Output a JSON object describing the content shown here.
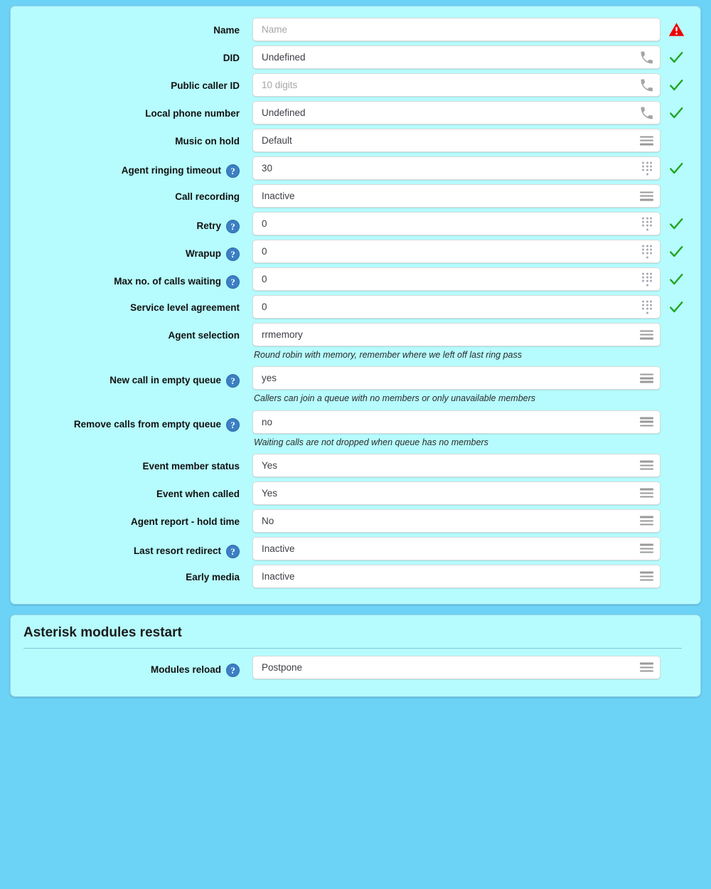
{
  "colors": {
    "page_background": "#6cd2f6",
    "panel_background": "#b6fbfd",
    "panel_border": "#8fd4e8",
    "field_background": "#ffffff",
    "help_badge": "#3b7fc4",
    "status_ok": "#22a522",
    "status_error": "#ee0000"
  },
  "queue_form": {
    "rows": [
      {
        "label": "Name",
        "help": false,
        "type": "text",
        "value": "Name",
        "is_placeholder": true,
        "field_icon": "none",
        "status": "error",
        "helper": ""
      },
      {
        "label": "DID",
        "help": false,
        "type": "text",
        "value": "Undefined",
        "is_placeholder": false,
        "field_icon": "phone",
        "status": "ok",
        "helper": ""
      },
      {
        "label": "Public caller ID",
        "help": false,
        "type": "text",
        "value": "10 digits",
        "is_placeholder": true,
        "field_icon": "phone",
        "status": "ok",
        "helper": ""
      },
      {
        "label": "Local phone number",
        "help": false,
        "type": "text",
        "value": "Undefined",
        "is_placeholder": false,
        "field_icon": "phone",
        "status": "ok",
        "helper": ""
      },
      {
        "label": "Music on hold",
        "help": false,
        "type": "select",
        "value": "Default",
        "is_placeholder": false,
        "field_icon": "menu",
        "status": "none",
        "helper": ""
      },
      {
        "label": "Agent ringing timeout",
        "help": true,
        "type": "number",
        "value": "30",
        "is_placeholder": false,
        "field_icon": "dialpad",
        "status": "ok",
        "helper": ""
      },
      {
        "label": "Call recording",
        "help": false,
        "type": "select",
        "value": "Inactive",
        "is_placeholder": false,
        "field_icon": "menu",
        "status": "none",
        "helper": ""
      },
      {
        "label": "Retry",
        "help": true,
        "type": "number",
        "value": "0",
        "is_placeholder": false,
        "field_icon": "dialpad",
        "status": "ok",
        "helper": ""
      },
      {
        "label": "Wrapup",
        "help": true,
        "type": "number",
        "value": "0",
        "is_placeholder": false,
        "field_icon": "dialpad",
        "status": "ok",
        "helper": ""
      },
      {
        "label": "Max no. of calls waiting",
        "help": true,
        "type": "number",
        "value": "0",
        "is_placeholder": false,
        "field_icon": "dialpad",
        "status": "ok",
        "helper": ""
      },
      {
        "label": "Service level agreement",
        "help": false,
        "type": "number",
        "value": "0",
        "is_placeholder": false,
        "field_icon": "dialpad",
        "status": "ok",
        "helper": ""
      },
      {
        "label": "Agent selection",
        "help": false,
        "type": "select",
        "value": "rrmemory",
        "is_placeholder": false,
        "field_icon": "menu",
        "status": "none",
        "helper": "Round robin with memory, remember where we left off last ring pass"
      },
      {
        "label": "New call in empty queue",
        "help": true,
        "type": "select",
        "value": "yes",
        "is_placeholder": false,
        "field_icon": "menu",
        "status": "none",
        "helper": "Callers can join a queue with no members or only unavailable members"
      },
      {
        "label": "Remove calls from empty queue",
        "help": true,
        "type": "select",
        "value": "no",
        "is_placeholder": false,
        "field_icon": "menu",
        "status": "none",
        "helper": "Waiting calls are not dropped when queue has no members"
      },
      {
        "label": "Event member status",
        "help": false,
        "type": "select",
        "value": "Yes",
        "is_placeholder": false,
        "field_icon": "menu",
        "status": "none",
        "helper": ""
      },
      {
        "label": "Event when called",
        "help": false,
        "type": "select",
        "value": "Yes",
        "is_placeholder": false,
        "field_icon": "menu",
        "status": "none",
        "helper": ""
      },
      {
        "label": "Agent report - hold time",
        "help": false,
        "type": "select",
        "value": "No",
        "is_placeholder": false,
        "field_icon": "menu",
        "status": "none",
        "helper": ""
      },
      {
        "label": "Last resort redirect",
        "help": true,
        "type": "select",
        "value": "Inactive",
        "is_placeholder": false,
        "field_icon": "menu",
        "status": "none",
        "helper": ""
      },
      {
        "label": "Early media",
        "help": false,
        "type": "select",
        "value": "Inactive",
        "is_placeholder": false,
        "field_icon": "menu",
        "status": "none",
        "helper": ""
      }
    ]
  },
  "modules_panel": {
    "title": "Asterisk modules restart",
    "rows": [
      {
        "label": "Modules reload",
        "help": true,
        "type": "select",
        "value": "Postpone",
        "is_placeholder": false,
        "field_icon": "menu",
        "status": "none",
        "helper": ""
      }
    ]
  },
  "help_glyph": "?"
}
